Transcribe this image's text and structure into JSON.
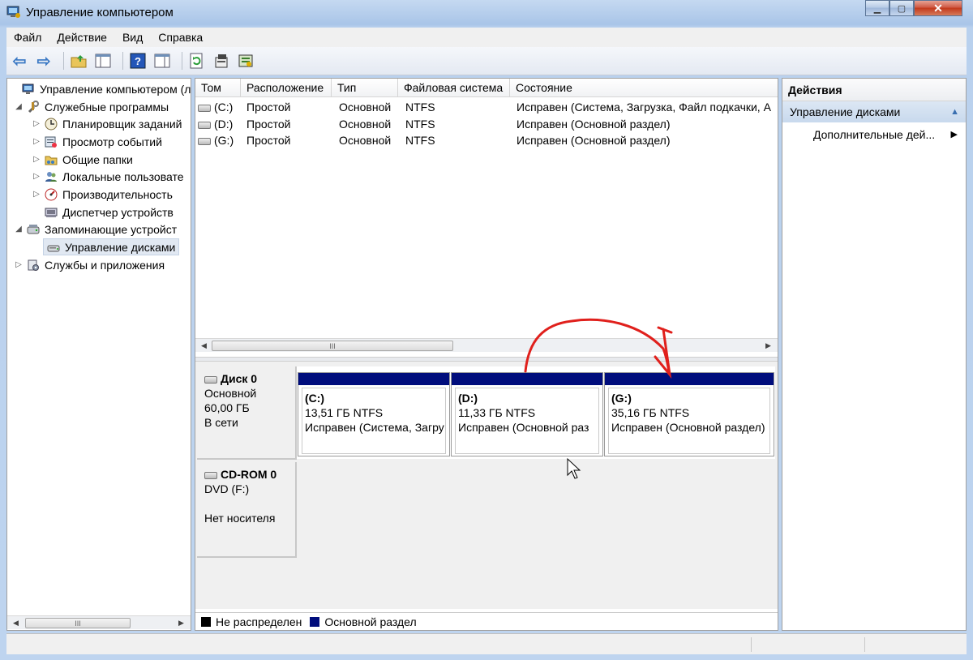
{
  "window": {
    "title": "Управление компьютером"
  },
  "menu": [
    "Файл",
    "Действие",
    "Вид",
    "Справка"
  ],
  "tree": {
    "items": [
      {
        "label": "Управление компьютером (л",
        "icon": "computer-management-icon",
        "exp": ""
      },
      {
        "label": "Служебные программы",
        "icon": "tools-icon",
        "exp": "◢"
      },
      {
        "label": "Планировщик заданий",
        "icon": "clock-icon",
        "exp": "▷"
      },
      {
        "label": "Просмотр событий",
        "icon": "event-viewer-icon",
        "exp": "▷"
      },
      {
        "label": "Общие папки",
        "icon": "shared-folders-icon",
        "exp": "▷"
      },
      {
        "label": "Локальные пользовате",
        "icon": "users-icon",
        "exp": "▷"
      },
      {
        "label": "Производительность",
        "icon": "performance-icon",
        "exp": "▷"
      },
      {
        "label": "Диспетчер устройств",
        "icon": "device-manager-icon",
        "exp": ""
      },
      {
        "label": "Запоминающие устройст",
        "icon": "storage-icon",
        "exp": "◢"
      },
      {
        "label": "Управление дисками",
        "icon": "disk-management-icon",
        "exp": ""
      },
      {
        "label": "Службы и приложения",
        "icon": "services-icon",
        "exp": "▷"
      }
    ],
    "scroll_grip": "III"
  },
  "volumes": {
    "columns": [
      "Том",
      "Расположение",
      "Тип",
      "Файловая система",
      "Состояние"
    ],
    "rows": [
      {
        "volume": "(C:)",
        "layout": "Простой",
        "type": "Основной",
        "fs": "NTFS",
        "status": "Исправен (Система, Загрузка, Файл подкачки, А"
      },
      {
        "volume": "(D:)",
        "layout": "Простой",
        "type": "Основной",
        "fs": "NTFS",
        "status": "Исправен (Основной раздел)"
      },
      {
        "volume": "(G:)",
        "layout": "Простой",
        "type": "Основной",
        "fs": "NTFS",
        "status": "Исправен (Основной раздел)"
      }
    ],
    "scroll_grip": "III"
  },
  "disks": [
    {
      "name": "Диск 0",
      "kind": "Основной",
      "size": "60,00 ГБ",
      "state": "В сети",
      "partitions": [
        {
          "name": "(C:)",
          "size": "13,51 ГБ NTFS",
          "status": "Исправен (Система, Загру"
        },
        {
          "name": "(D:)",
          "size": "11,33 ГБ NTFS",
          "status": "Исправен (Основной раз"
        },
        {
          "name": "(G:)",
          "size": "35,16 ГБ NTFS",
          "status": "Исправен (Основной раздел)"
        }
      ]
    },
    {
      "name": "CD-ROM 0",
      "kind": "DVD (F:)",
      "state": "Нет носителя"
    }
  ],
  "legend": [
    {
      "label": "Не распределен",
      "color": "#000000"
    },
    {
      "label": "Основной раздел",
      "color": "#000d7c"
    }
  ],
  "actions": {
    "title": "Действия",
    "section": "Управление дисками",
    "more": "Дополнительные дей..."
  },
  "annotation": {
    "color": "#e0201c"
  }
}
